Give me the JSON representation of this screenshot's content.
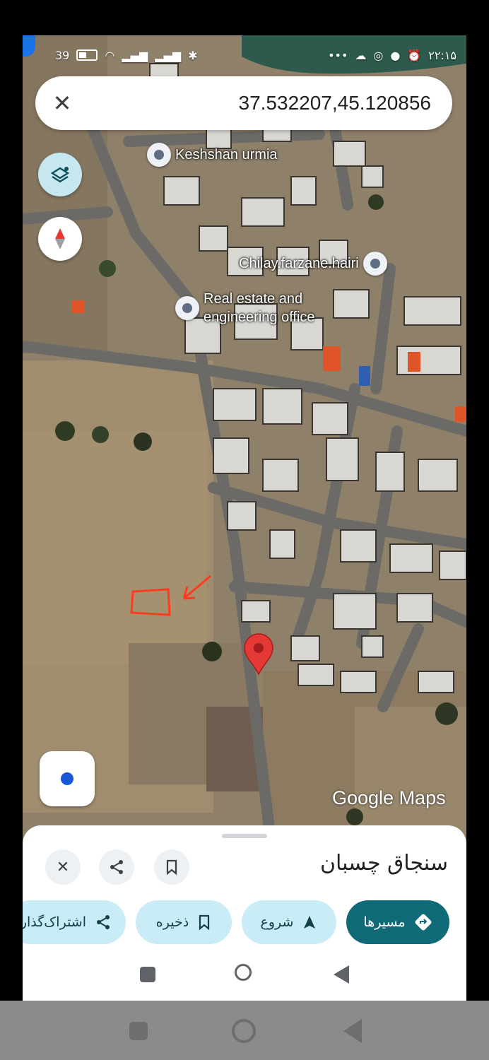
{
  "status_bar": {
    "battery": "39",
    "time": "۲۲:۱۵"
  },
  "search": {
    "query": "37.532207,45.120856"
  },
  "map": {
    "places": [
      {
        "name": "Keshshan urmia"
      },
      {
        "name": "Chilay.farzane.hairi"
      },
      {
        "name": "Real estate and\nengineering office"
      }
    ],
    "watermark": "Google Maps"
  },
  "sheet": {
    "title": "سنجاق چسبان",
    "actions": [
      {
        "label": "مسیرها",
        "icon": "directions-icon"
      },
      {
        "label": "شروع",
        "icon": "navigation-arrow-icon"
      },
      {
        "label": "ذخیره",
        "icon": "bookmark-icon"
      },
      {
        "label": "اشتراک‌گذاری",
        "icon": "share-icon"
      }
    ]
  },
  "colors": {
    "accent": "#0f6b78",
    "chip": "#c9ecf6",
    "pin": "#e53935",
    "annotation": "#ff3b1f"
  }
}
